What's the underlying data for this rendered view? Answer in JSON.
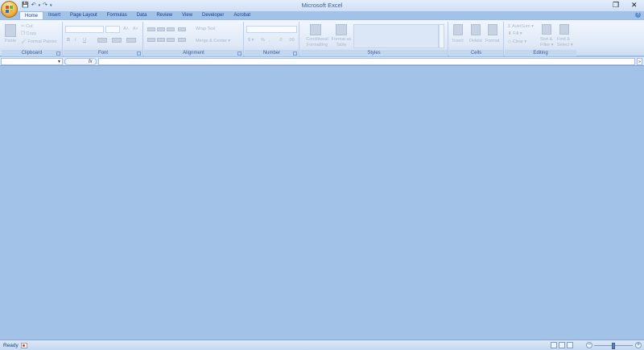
{
  "window": {
    "title": "Microsoft Excel",
    "restore_glyph": "❐",
    "close_glyph": "✕"
  },
  "qat": {
    "save": "💾",
    "undo": "↶",
    "redo": "↷",
    "customize": "▾"
  },
  "tabs": [
    {
      "label": "Home",
      "active": true
    },
    {
      "label": "Insert"
    },
    {
      "label": "Page Layout"
    },
    {
      "label": "Formulas"
    },
    {
      "label": "Data"
    },
    {
      "label": "Review"
    },
    {
      "label": "View"
    },
    {
      "label": "Developer"
    },
    {
      "label": "Acrobat"
    }
  ],
  "ribbon": {
    "clipboard": {
      "label": "Clipboard",
      "paste": "Paste",
      "cut": "Cut",
      "copy": "Copy",
      "format_painter": "Format Painter"
    },
    "font": {
      "label": "Font",
      "bold": "B",
      "italic": "I",
      "underline": "U",
      "grow": "A˄",
      "shrink": "A˅"
    },
    "alignment": {
      "label": "Alignment",
      "wrap_text": "Wrap Text",
      "merge_center": "Merge & Center ▾"
    },
    "number": {
      "label": "Number",
      "currency": "$ ▾",
      "percent": "%",
      "comma": ",",
      "inc_dec": ".0",
      "dec_dec": ".00"
    },
    "styles": {
      "label": "Styles",
      "conditional_formatting": "Conditional Formatting",
      "format_as_table": "Format as Table"
    },
    "cells": {
      "label": "Cells",
      "insert": "Insert",
      "delete": "Delete",
      "format": "Format"
    },
    "editing": {
      "label": "Editing",
      "autosum": "AutoSum ▾",
      "fill": "Fill ▾",
      "clear": "Clear ▾",
      "sort_filter": "Sort & Filter ▾",
      "find_select": "Find & Select ▾"
    }
  },
  "formula_bar": {
    "fx_label": "fx",
    "expand": "»"
  },
  "status": {
    "text": "Ready",
    "zoom_minus": "−",
    "zoom_plus": "+"
  },
  "colors": {
    "workspace": "#a3c2e8",
    "ribbon_text": "#15428b"
  }
}
